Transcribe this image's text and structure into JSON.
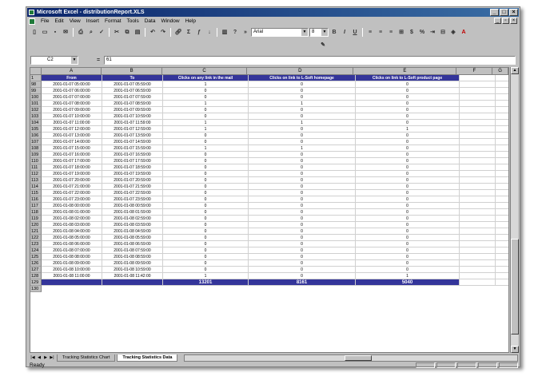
{
  "window": {
    "title": "Microsoft Excel - distributionReport.XLS"
  },
  "menu": [
    "File",
    "Edit",
    "View",
    "Insert",
    "Format",
    "Tools",
    "Data",
    "Window",
    "Help"
  ],
  "toolbar": {
    "font": "Arial",
    "size": "8"
  },
  "formula_bar": {
    "cell_ref": "C2",
    "equals": "=",
    "value": "61"
  },
  "columns": [
    "A",
    "B",
    "C",
    "D",
    "E",
    "F",
    "G"
  ],
  "header_row": {
    "row_num": "1",
    "cells": [
      "From",
      "To",
      "Clicks on any link in the mail",
      "Clicks on link to L-Soft homepage",
      "Clicks on link to L-Soft product page"
    ]
  },
  "rows": [
    {
      "n": "98",
      "a": "2001-01-07 05:00:00",
      "b": "2001-01-07 05:59:00",
      "c": "1",
      "d": "0",
      "e": "0"
    },
    {
      "n": "99",
      "a": "2001-01-07 06:00:00",
      "b": "2001-01-07 06:59:00",
      "c": "0",
      "d": "0",
      "e": "0"
    },
    {
      "n": "100",
      "a": "2001-01-07 07:00:00",
      "b": "2001-01-07 07:59:00",
      "c": "0",
      "d": "0",
      "e": "0"
    },
    {
      "n": "101",
      "a": "2001-01-07 08:00:00",
      "b": "2001-01-07 08:59:00",
      "c": "1",
      "d": "1",
      "e": "0"
    },
    {
      "n": "102",
      "a": "2001-01-07 09:00:00",
      "b": "2001-01-07 09:59:00",
      "c": "0",
      "d": "0",
      "e": "0"
    },
    {
      "n": "103",
      "a": "2001-01-07 10:00:00",
      "b": "2001-01-07 10:59:00",
      "c": "0",
      "d": "0",
      "e": "0"
    },
    {
      "n": "104",
      "a": "2001-01-07 11:00:00",
      "b": "2001-01-07 11:59:00",
      "c": "1",
      "d": "1",
      "e": "0"
    },
    {
      "n": "105",
      "a": "2001-01-07 12:00:00",
      "b": "2001-01-07 12:59:00",
      "c": "1",
      "d": "0",
      "e": "1"
    },
    {
      "n": "106",
      "a": "2001-01-07 13:00:00",
      "b": "2001-01-07 13:59:00",
      "c": "0",
      "d": "0",
      "e": "0"
    },
    {
      "n": "107",
      "a": "2001-01-07 14:00:00",
      "b": "2001-01-07 14:59:00",
      "c": "0",
      "d": "0",
      "e": "0"
    },
    {
      "n": "108",
      "a": "2001-01-07 15:00:00",
      "b": "2001-01-07 15:59:00",
      "c": "1",
      "d": "1",
      "e": "0"
    },
    {
      "n": "109",
      "a": "2001-01-07 16:00:00",
      "b": "2001-01-07 16:59:00",
      "c": "0",
      "d": "0",
      "e": "0"
    },
    {
      "n": "110",
      "a": "2001-01-07 17:00:00",
      "b": "2001-01-07 17:59:00",
      "c": "0",
      "d": "0",
      "e": "0"
    },
    {
      "n": "111",
      "a": "2001-01-07 18:00:00",
      "b": "2001-01-07 18:59:00",
      "c": "0",
      "d": "0",
      "e": "0"
    },
    {
      "n": "112",
      "a": "2001-01-07 19:00:00",
      "b": "2001-01-07 19:59:00",
      "c": "0",
      "d": "0",
      "e": "0"
    },
    {
      "n": "113",
      "a": "2001-01-07 20:00:00",
      "b": "2001-01-07 20:59:00",
      "c": "0",
      "d": "0",
      "e": "0"
    },
    {
      "n": "114",
      "a": "2001-01-07 21:00:00",
      "b": "2001-01-07 21:59:00",
      "c": "0",
      "d": "0",
      "e": "0"
    },
    {
      "n": "115",
      "a": "2001-01-07 22:00:00",
      "b": "2001-01-07 22:59:00",
      "c": "0",
      "d": "0",
      "e": "0"
    },
    {
      "n": "116",
      "a": "2001-01-07 23:00:00",
      "b": "2001-01-07 23:59:00",
      "c": "0",
      "d": "0",
      "e": "0"
    },
    {
      "n": "117",
      "a": "2001-01-08 00:00:00",
      "b": "2001-01-08 00:59:00",
      "c": "0",
      "d": "0",
      "e": "0"
    },
    {
      "n": "118",
      "a": "2001-01-08 01:00:00",
      "b": "2001-01-08 01:59:00",
      "c": "0",
      "d": "0",
      "e": "0"
    },
    {
      "n": "119",
      "a": "2001-01-08 02:00:00",
      "b": "2001-01-08 02:59:00",
      "c": "0",
      "d": "0",
      "e": "0"
    },
    {
      "n": "120",
      "a": "2001-01-08 03:00:00",
      "b": "2001-01-08 03:59:00",
      "c": "0",
      "d": "0",
      "e": "0"
    },
    {
      "n": "121",
      "a": "2001-01-08 04:00:00",
      "b": "2001-01-08 04:59:00",
      "c": "0",
      "d": "0",
      "e": "0"
    },
    {
      "n": "122",
      "a": "2001-01-08 05:00:00",
      "b": "2001-01-08 05:59:00",
      "c": "0",
      "d": "0",
      "e": "0"
    },
    {
      "n": "123",
      "a": "2001-01-08 06:00:00",
      "b": "2001-01-08 06:59:00",
      "c": "0",
      "d": "0",
      "e": "0"
    },
    {
      "n": "124",
      "a": "2001-01-08 07:00:00",
      "b": "2001-01-08 07:59:00",
      "c": "0",
      "d": "0",
      "e": "0"
    },
    {
      "n": "125",
      "a": "2001-01-08 08:00:00",
      "b": "2001-01-08 08:59:00",
      "c": "0",
      "d": "0",
      "e": "0"
    },
    {
      "n": "126",
      "a": "2001-01-08 09:00:00",
      "b": "2001-01-08 09:59:00",
      "c": "0",
      "d": "0",
      "e": "0"
    },
    {
      "n": "127",
      "a": "2001-01-08 10:00:00",
      "b": "2001-01-08 10:59:00",
      "c": "0",
      "d": "0",
      "e": "0"
    },
    {
      "n": "128",
      "a": "2001-01-08 11:00:00",
      "b": "2001-01-08 11:42:00",
      "c": "1",
      "d": "0",
      "e": "1"
    }
  ],
  "total_row": {
    "n": "129",
    "c": "13201",
    "d": "8161",
    "e": "5040"
  },
  "empty_row": {
    "n": "130"
  },
  "sheet_tabs": [
    "Tracking Statistics Chart",
    "Tracking Statistics Data"
  ],
  "active_tab": "Tracking Statistics Data",
  "status": "Ready",
  "colors": {
    "header_fill": "#34359a",
    "title_bar": "#0a246a",
    "chrome": "#c0c0c0"
  }
}
